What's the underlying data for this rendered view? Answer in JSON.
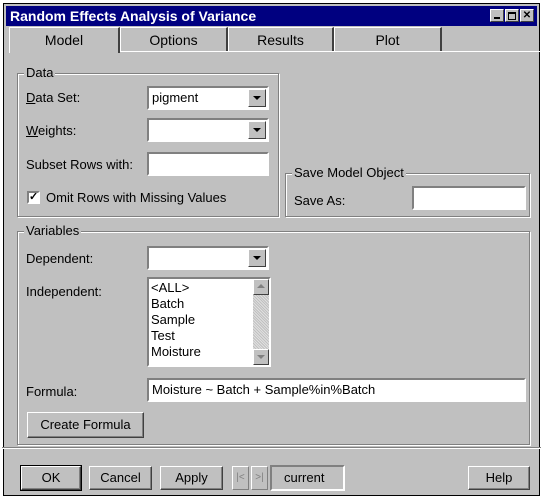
{
  "window": {
    "title": "Random Effects Analysis of Variance"
  },
  "tabs": [
    {
      "label": "Model",
      "active": true
    },
    {
      "label": "Options",
      "active": false
    },
    {
      "label": "Results",
      "active": false
    },
    {
      "label": "Plot",
      "active": false
    }
  ],
  "data_group": {
    "legend": "Data",
    "data_set_label": "Data Set:",
    "data_set_value": "pigment",
    "weights_label": "Weights:",
    "weights_value": "",
    "subset_label": "Subset Rows with:",
    "subset_value": "",
    "omit_missing_label": "Omit Rows with Missing Values",
    "omit_missing_checked": true
  },
  "save_group": {
    "legend": "Save Model Object",
    "save_as_label": "Save As:",
    "save_as_value": ""
  },
  "variables_group": {
    "legend": "Variables",
    "dependent_label": "Dependent:",
    "dependent_value": "",
    "independent_label": "Independent:",
    "independent_items": [
      "<ALL>",
      "Batch",
      "Sample",
      "Test",
      "Moisture"
    ],
    "formula_label": "Formula:",
    "formula_value": "Moisture ~ Batch + Sample%in%Batch",
    "create_formula_label": "Create Formula"
  },
  "footer": {
    "ok_label": "OK",
    "cancel_label": "Cancel",
    "apply_label": "Apply",
    "prev_glyph": "|<",
    "next_glyph": ">|",
    "current_label": "current",
    "help_label": "Help"
  }
}
